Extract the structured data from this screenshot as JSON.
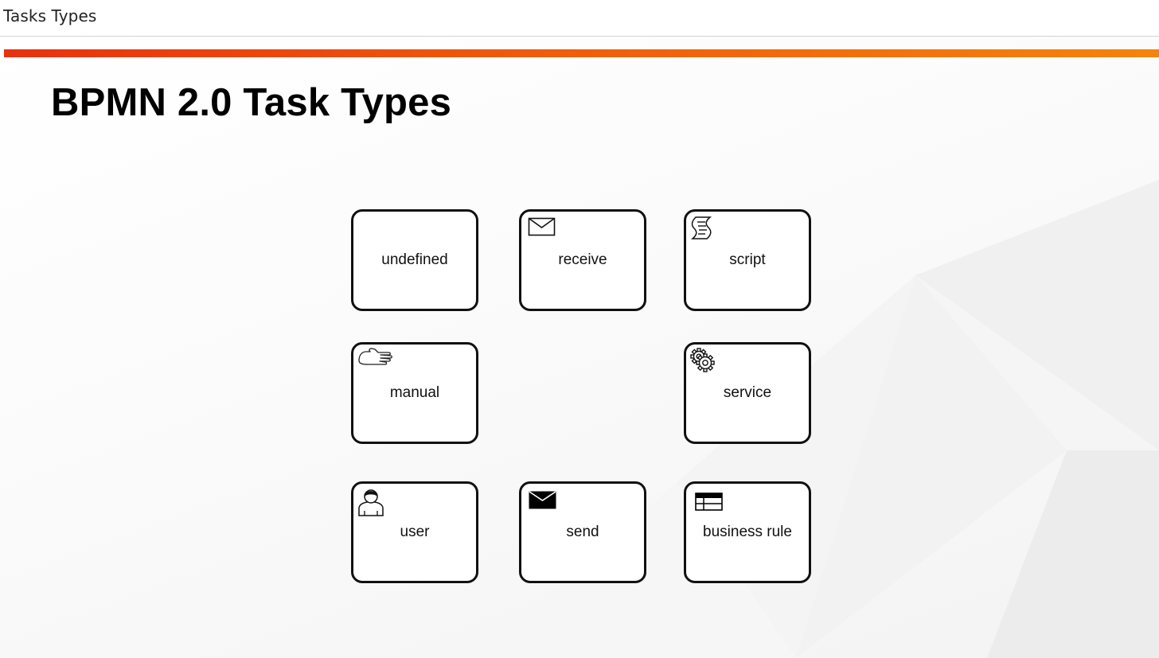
{
  "header": {
    "title": "Tasks Types"
  },
  "slide": {
    "title": "BPMN 2.0 Task Types",
    "tasks": [
      {
        "label": "undefined",
        "icon": "none"
      },
      {
        "label": "receive",
        "icon": "envelope-outline-icon"
      },
      {
        "label": "script",
        "icon": "script-scroll-icon"
      },
      {
        "label": "manual",
        "icon": "hand-icon"
      },
      {
        "label": "service",
        "icon": "gears-icon"
      },
      {
        "label": "user",
        "icon": "user-icon"
      },
      {
        "label": "send",
        "icon": "envelope-filled-icon"
      },
      {
        "label": "business rule",
        "icon": "table-icon"
      }
    ]
  },
  "colors": {
    "accent_start": "#e8320e",
    "accent_end": "#f5830c",
    "stroke": "#111111"
  }
}
